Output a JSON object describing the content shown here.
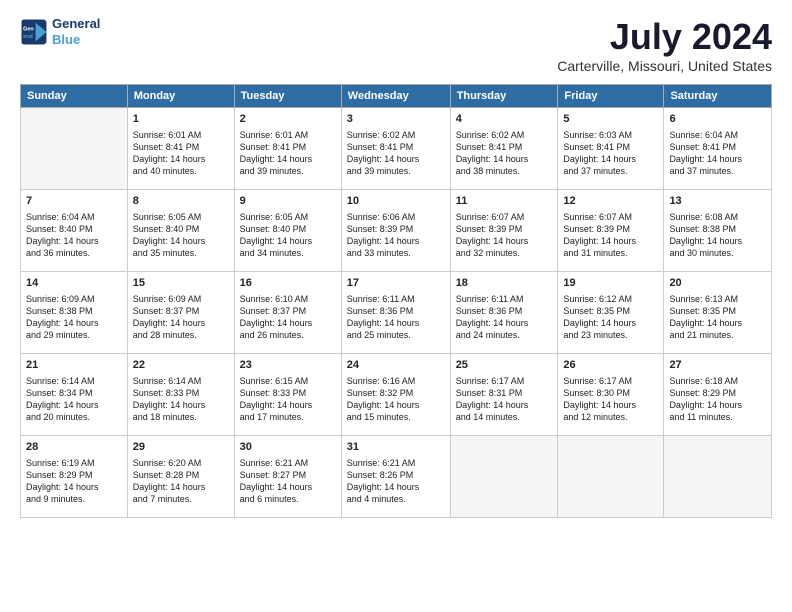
{
  "logo": {
    "line1": "General",
    "line2": "Blue"
  },
  "title": "July 2024",
  "subtitle": "Carterville, Missouri, United States",
  "headers": [
    "Sunday",
    "Monday",
    "Tuesday",
    "Wednesday",
    "Thursday",
    "Friday",
    "Saturday"
  ],
  "weeks": [
    [
      {
        "day": "",
        "sunrise": "",
        "sunset": "",
        "daylight": ""
      },
      {
        "day": "1",
        "sunrise": "6:01 AM",
        "sunset": "8:41 PM",
        "daylight": "14 hours and 40 minutes."
      },
      {
        "day": "2",
        "sunrise": "6:01 AM",
        "sunset": "8:41 PM",
        "daylight": "14 hours and 39 minutes."
      },
      {
        "day": "3",
        "sunrise": "6:02 AM",
        "sunset": "8:41 PM",
        "daylight": "14 hours and 39 minutes."
      },
      {
        "day": "4",
        "sunrise": "6:02 AM",
        "sunset": "8:41 PM",
        "daylight": "14 hours and 38 minutes."
      },
      {
        "day": "5",
        "sunrise": "6:03 AM",
        "sunset": "8:41 PM",
        "daylight": "14 hours and 37 minutes."
      },
      {
        "day": "6",
        "sunrise": "6:04 AM",
        "sunset": "8:41 PM",
        "daylight": "14 hours and 37 minutes."
      }
    ],
    [
      {
        "day": "7",
        "sunrise": "6:04 AM",
        "sunset": "8:40 PM",
        "daylight": "14 hours and 36 minutes."
      },
      {
        "day": "8",
        "sunrise": "6:05 AM",
        "sunset": "8:40 PM",
        "daylight": "14 hours and 35 minutes."
      },
      {
        "day": "9",
        "sunrise": "6:05 AM",
        "sunset": "8:40 PM",
        "daylight": "14 hours and 34 minutes."
      },
      {
        "day": "10",
        "sunrise": "6:06 AM",
        "sunset": "8:39 PM",
        "daylight": "14 hours and 33 minutes."
      },
      {
        "day": "11",
        "sunrise": "6:07 AM",
        "sunset": "8:39 PM",
        "daylight": "14 hours and 32 minutes."
      },
      {
        "day": "12",
        "sunrise": "6:07 AM",
        "sunset": "8:39 PM",
        "daylight": "14 hours and 31 minutes."
      },
      {
        "day": "13",
        "sunrise": "6:08 AM",
        "sunset": "8:38 PM",
        "daylight": "14 hours and 30 minutes."
      }
    ],
    [
      {
        "day": "14",
        "sunrise": "6:09 AM",
        "sunset": "8:38 PM",
        "daylight": "14 hours and 29 minutes."
      },
      {
        "day": "15",
        "sunrise": "6:09 AM",
        "sunset": "8:37 PM",
        "daylight": "14 hours and 28 minutes."
      },
      {
        "day": "16",
        "sunrise": "6:10 AM",
        "sunset": "8:37 PM",
        "daylight": "14 hours and 26 minutes."
      },
      {
        "day": "17",
        "sunrise": "6:11 AM",
        "sunset": "8:36 PM",
        "daylight": "14 hours and 25 minutes."
      },
      {
        "day": "18",
        "sunrise": "6:11 AM",
        "sunset": "8:36 PM",
        "daylight": "14 hours and 24 minutes."
      },
      {
        "day": "19",
        "sunrise": "6:12 AM",
        "sunset": "8:35 PM",
        "daylight": "14 hours and 23 minutes."
      },
      {
        "day": "20",
        "sunrise": "6:13 AM",
        "sunset": "8:35 PM",
        "daylight": "14 hours and 21 minutes."
      }
    ],
    [
      {
        "day": "21",
        "sunrise": "6:14 AM",
        "sunset": "8:34 PM",
        "daylight": "14 hours and 20 minutes."
      },
      {
        "day": "22",
        "sunrise": "6:14 AM",
        "sunset": "8:33 PM",
        "daylight": "14 hours and 18 minutes."
      },
      {
        "day": "23",
        "sunrise": "6:15 AM",
        "sunset": "8:33 PM",
        "daylight": "14 hours and 17 minutes."
      },
      {
        "day": "24",
        "sunrise": "6:16 AM",
        "sunset": "8:32 PM",
        "daylight": "14 hours and 15 minutes."
      },
      {
        "day": "25",
        "sunrise": "6:17 AM",
        "sunset": "8:31 PM",
        "daylight": "14 hours and 14 minutes."
      },
      {
        "day": "26",
        "sunrise": "6:17 AM",
        "sunset": "8:30 PM",
        "daylight": "14 hours and 12 minutes."
      },
      {
        "day": "27",
        "sunrise": "6:18 AM",
        "sunset": "8:29 PM",
        "daylight": "14 hours and 11 minutes."
      }
    ],
    [
      {
        "day": "28",
        "sunrise": "6:19 AM",
        "sunset": "8:29 PM",
        "daylight": "14 hours and 9 minutes."
      },
      {
        "day": "29",
        "sunrise": "6:20 AM",
        "sunset": "8:28 PM",
        "daylight": "14 hours and 7 minutes."
      },
      {
        "day": "30",
        "sunrise": "6:21 AM",
        "sunset": "8:27 PM",
        "daylight": "14 hours and 6 minutes."
      },
      {
        "day": "31",
        "sunrise": "6:21 AM",
        "sunset": "8:26 PM",
        "daylight": "14 hours and 4 minutes."
      },
      {
        "day": "",
        "sunrise": "",
        "sunset": "",
        "daylight": ""
      },
      {
        "day": "",
        "sunrise": "",
        "sunset": "",
        "daylight": ""
      },
      {
        "day": "",
        "sunrise": "",
        "sunset": "",
        "daylight": ""
      }
    ]
  ]
}
